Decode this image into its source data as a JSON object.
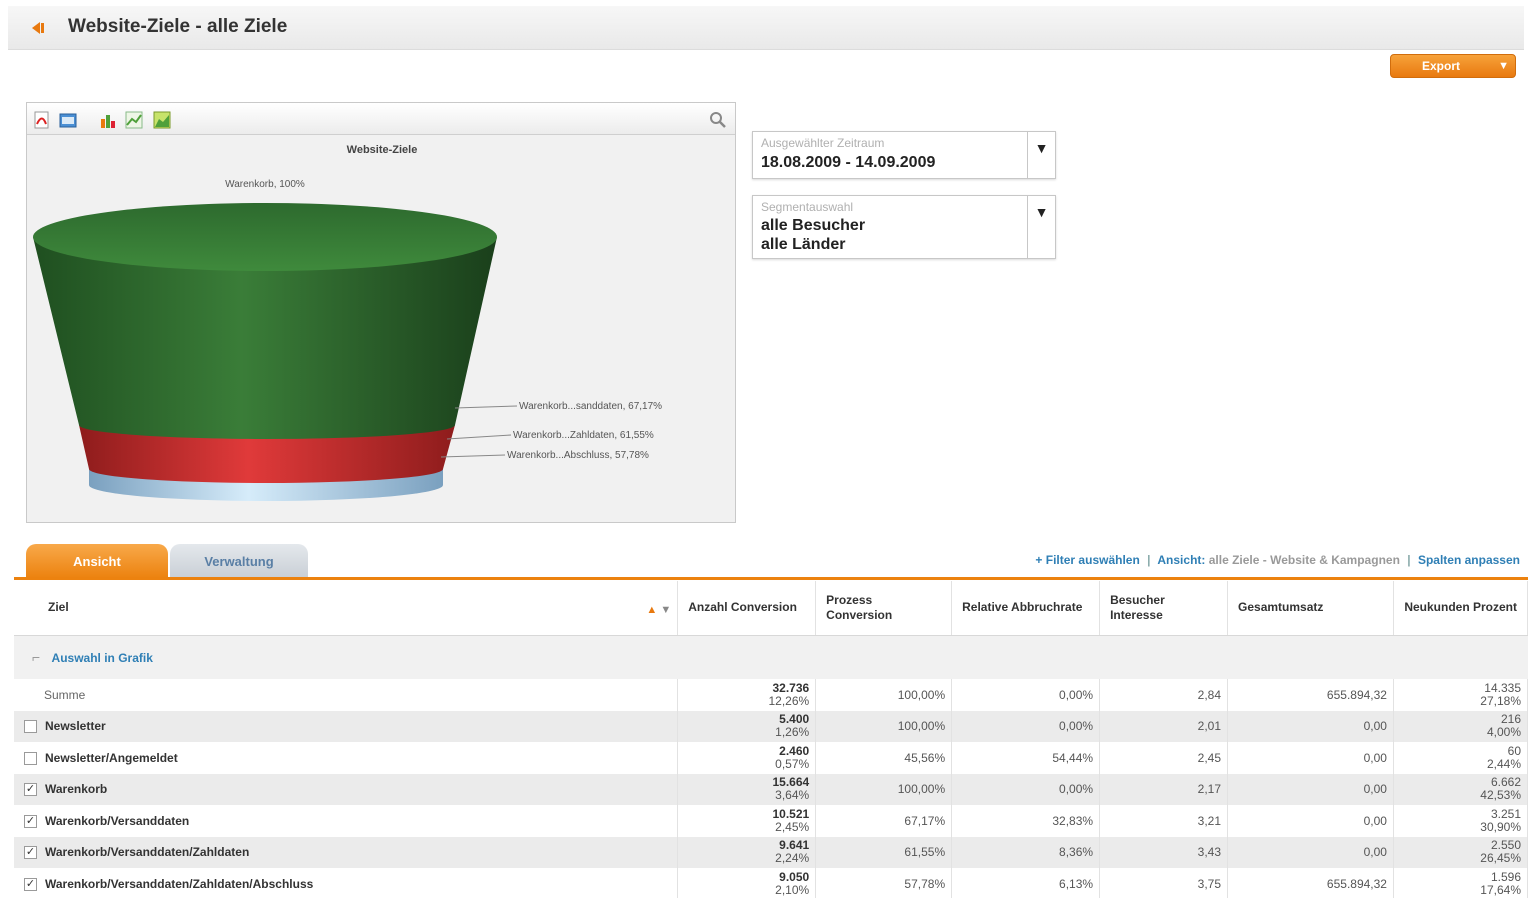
{
  "header": {
    "title": "Website-Ziele - alle Ziele",
    "back_icon": "back-arrow-icon"
  },
  "export": {
    "label": "Export"
  },
  "chart": {
    "title": "Website-Ziele",
    "toolbar_icons": [
      "pdf-icon",
      "image-icon",
      "bar-chart-icon",
      "line-chart-icon",
      "area-chart-icon"
    ],
    "zoom_icon": "magnify-icon",
    "labels": {
      "top": "Warenkorb, 100%",
      "l1": "Warenkorb...sanddaten, 67,17%",
      "l2": "Warenkorb...Zahldaten, 61,55%",
      "l3": "Warenkorb...Abschluss, 57,78%"
    },
    "colors": {
      "green": "#2e6e2f",
      "red": "#c82a2a",
      "blue": "#9cc6e4"
    }
  },
  "chart_data": {
    "type": "funnel",
    "title": "Website-Ziele",
    "categories": [
      "Warenkorb",
      "Warenkorb/Versanddaten",
      "Warenkorb/Versanddaten/Zahldaten",
      "Warenkorb/Versanddaten/Zahldaten/Abschluss"
    ],
    "values": [
      100,
      67.17,
      61.55,
      57.78
    ]
  },
  "filters": {
    "period": {
      "label": "Ausgewählter Zeitraum",
      "value": "18.08.2009 - 14.09.2009"
    },
    "segment": {
      "label": "Segmentauswahl",
      "value1": "alle Besucher",
      "value2": "alle Länder"
    }
  },
  "tabs": {
    "active": "Ansicht",
    "inactive": "Verwaltung"
  },
  "links": {
    "filter": "+ Filter auswählen",
    "view_prefix": "Ansicht:",
    "view_value": "alle Ziele - Website & Kampagnen",
    "columns": "Spalten anpassen"
  },
  "table": {
    "headers": {
      "ziel": "Ziel",
      "anzahl": "Anzahl Conversion",
      "prozess": "Prozess Conversion",
      "relative": "Relative Abbruchrate",
      "besucher": "Besucher Interesse",
      "umsatz": "Gesamtumsatz",
      "neukunden": "Neukunden Prozent"
    },
    "group_label": "Auswahl in Grafik",
    "sum": {
      "label": "Summe",
      "anzahl": "32.736",
      "anzahl_pct": "12,26%",
      "prozess": "100,00%",
      "relative": "0,00%",
      "besucher": "2,84",
      "umsatz": "655.894,32",
      "neu": "14.335",
      "neu_pct": "27,18%"
    },
    "rows": [
      {
        "name": "Newsletter",
        "checked": "",
        "anzahl": "5.400",
        "anzahl_pct": "1,26%",
        "prozess": "100,00%",
        "relative": "0,00%",
        "besucher": "2,01",
        "umsatz": "0,00",
        "neu": "216",
        "neu_pct": "4,00%"
      },
      {
        "name": "Newsletter/Angemeldet",
        "checked": "",
        "anzahl": "2.460",
        "anzahl_pct": "0,57%",
        "prozess": "45,56%",
        "relative": "54,44%",
        "besucher": "2,45",
        "umsatz": "0,00",
        "neu": "60",
        "neu_pct": "2,44%"
      },
      {
        "name": "Warenkorb",
        "checked": "✓",
        "anzahl": "15.664",
        "anzahl_pct": "3,64%",
        "prozess": "100,00%",
        "relative": "0,00%",
        "besucher": "2,17",
        "umsatz": "0,00",
        "neu": "6.662",
        "neu_pct": "42,53%"
      },
      {
        "name": "Warenkorb/Versanddaten",
        "checked": "✓",
        "anzahl": "10.521",
        "anzahl_pct": "2,45%",
        "prozess": "67,17%",
        "relative": "32,83%",
        "besucher": "3,21",
        "umsatz": "0,00",
        "neu": "3.251",
        "neu_pct": "30,90%"
      },
      {
        "name": "Warenkorb/Versanddaten/Zahldaten",
        "checked": "✓",
        "anzahl": "9.641",
        "anzahl_pct": "2,24%",
        "prozess": "61,55%",
        "relative": "8,36%",
        "besucher": "3,43",
        "umsatz": "0,00",
        "neu": "2.550",
        "neu_pct": "26,45%"
      },
      {
        "name": "Warenkorb/Versanddaten/Zahldaten/Abschluss",
        "checked": "✓",
        "anzahl": "9.050",
        "anzahl_pct": "2,10%",
        "prozess": "57,78%",
        "relative": "6,13%",
        "besucher": "3,75",
        "umsatz": "655.894,32",
        "neu": "1.596",
        "neu_pct": "17,64%"
      }
    ]
  }
}
